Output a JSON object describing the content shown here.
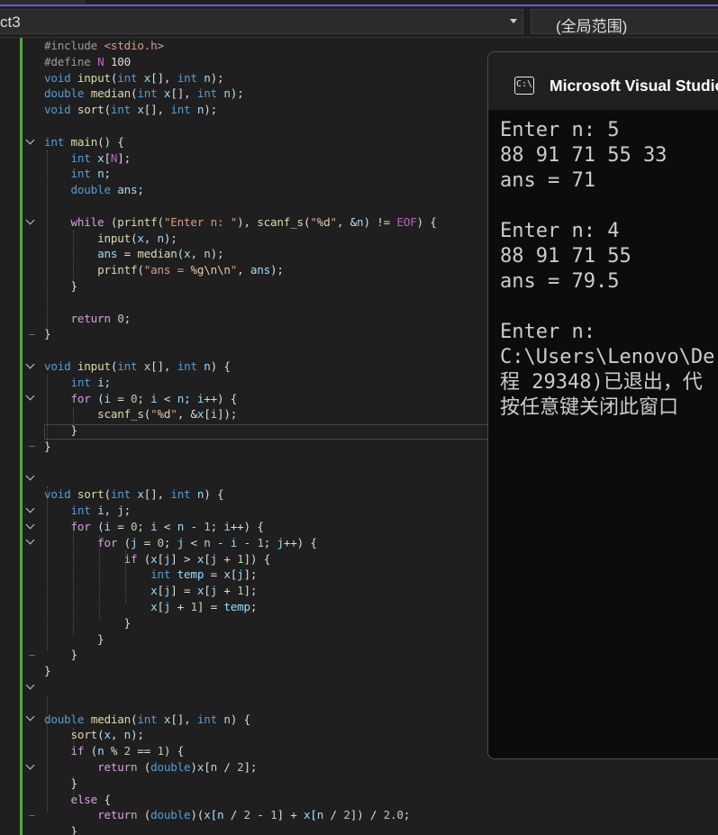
{
  "navbar": {
    "project_name": "ct3",
    "scope_name": "(全局范围)"
  },
  "editor": {
    "code_lines": [
      "#include <stdio.h>",
      "#define N 100",
      "void input(int x[], int n);",
      "double median(int x[], int n);",
      "void sort(int x[], int n);",
      "",
      "int main() {",
      "    int x[N];",
      "    int n;",
      "    double ans;",
      "",
      "    while (printf(\"Enter n: \"), scanf_s(\"%d\", &n) != EOF) {",
      "        input(x, n);",
      "        ans = median(x, n);",
      "        printf(\"ans = %g\\n\\n\", ans);",
      "    }",
      "",
      "    return 0;",
      "}",
      "",
      "void input(int x[], int n) {",
      "    int i;",
      "    for (i = 0; i < n; i++) {",
      "        scanf_s(\"%d\", &x[i]);",
      "    }",
      "}",
      "",
      "",
      "void sort(int x[], int n) {",
      "    int i, j;",
      "    for (i = 0; i < n - 1; i++) {",
      "        for (j = 0; j < n - i - 1; j++) {",
      "            if (x[j] > x[j + 1]) {",
      "                int temp = x[j];",
      "                x[j] = x[j + 1];",
      "                x[j + 1] = temp;",
      "            }",
      "        }",
      "    }",
      "}",
      "",
      "",
      "double median(int x[], int n) {",
      "    sort(x, n);",
      "    if (n % 2 == 1) {",
      "        return (double)x[n / 2];",
      "    }",
      "    else {",
      "        return (double)(x[n / 2 - 1] + x[n / 2]) / 2.0;",
      "    }",
      "}"
    ]
  },
  "console": {
    "title": "Microsoft Visual Studio",
    "icon": "console-app-icon",
    "icon_text": "C:\\",
    "lines": [
      "Enter n: 5",
      "88 91 71 55 33",
      "ans = 71",
      "",
      "Enter n: 4",
      "88 91 71 55",
      "ans = 79.5",
      "",
      "Enter n:",
      "C:\\Users\\Lenovo\\De",
      "程 29348)已退出，代",
      "按任意键关闭此窗口"
    ]
  },
  "colors": {
    "editor_bg": "#1f1f1f",
    "keyword": "#569cd6",
    "function": "#dcdcaa",
    "variable": "#9cdcfe",
    "string": "#d69d85",
    "change_bar": "#56a33a",
    "console_bg": "#0c0c0c"
  }
}
